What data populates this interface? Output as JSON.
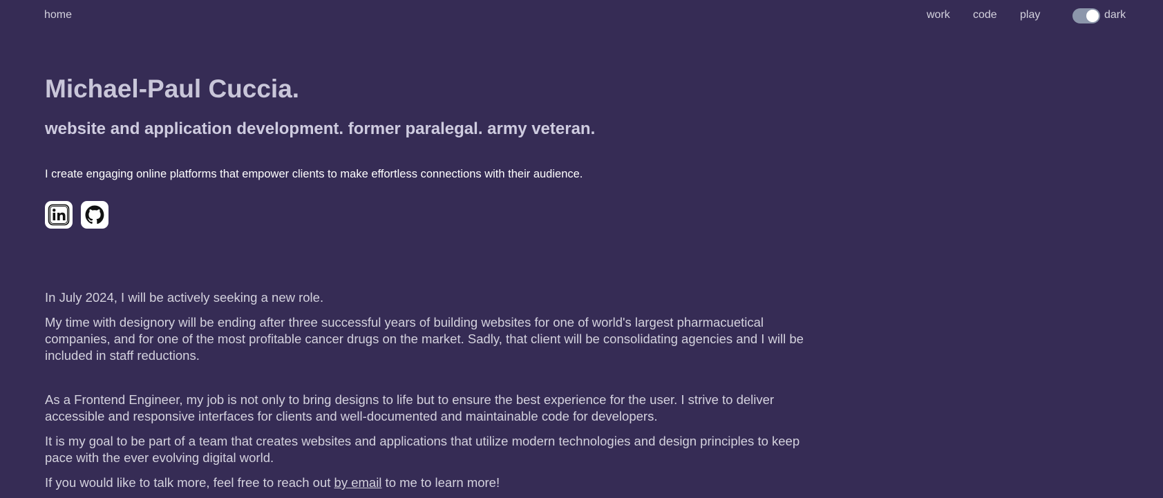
{
  "nav": {
    "home": "home",
    "work": "work",
    "code": "code",
    "play": "play",
    "theme_label": "dark"
  },
  "hero": {
    "title": "Michael-Paul Cuccia.",
    "tagline": "website and application development. former paralegal. army veteran.",
    "intro": "I create engaging online platforms that empower clients to make effortless connections with their audience."
  },
  "social": [
    {
      "name": "linkedin",
      "icon": "linkedin-icon"
    },
    {
      "name": "github",
      "icon": "github-icon"
    }
  ],
  "about": {
    "p1": "In July 2024, I will be actively seeking a new role.",
    "p2": "My time with designory will be ending after three successful years of building websites for one of world's largest pharmacuetical companies, and for one of the most profitable cancer drugs on the market. Sadly, that client will be consolidating agencies and I will be included in staff reductions.",
    "p3": "As a Frontend Engineer, my job is not only to bring designs to life but to ensure the best experience for the user. I strive to deliver accessible and responsive interfaces for clients and well-documented and maintainable code for developers.",
    "p4": "It is my goal to be part of a team that creates websites and applications that utilize modern technologies and design principles to keep pace with the ever evolving digital world.",
    "p5_before": "If you would like to talk more, feel free to reach out ",
    "p5_link": "by email",
    "p5_after": " to me to learn more!"
  },
  "colors": {
    "background": "#362c55",
    "text": "#d4d2de",
    "toggle_track": "#8c96ab"
  }
}
